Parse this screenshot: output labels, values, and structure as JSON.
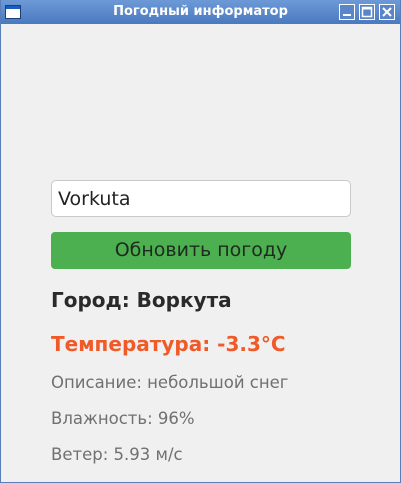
{
  "window": {
    "title": "Погодный информатор",
    "title_color": "#ffffff",
    "titlebar_color": "#4a79c0"
  },
  "search": {
    "value": "Vorkuta",
    "placeholder": ""
  },
  "refresh_button": {
    "label": "Обновить погоду",
    "color": "#4caf50"
  },
  "weather": {
    "city_text": "Город: Воркута",
    "temperature_text": "Температура: -3.3°C",
    "temperature_color": "#f05a28",
    "description_text": "Описание: небольшой снег",
    "humidity_text": "Влажность: 96%",
    "wind_text": "Ветер: 5.93 м/с"
  },
  "icons": {
    "app": "window-icon",
    "minimize": "minimize-icon",
    "maximize": "maximize-icon",
    "close": "close-icon"
  }
}
